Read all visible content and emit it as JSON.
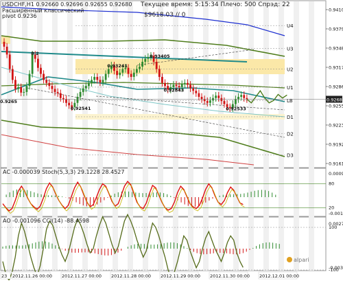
{
  "header": {
    "symbol_line": "USDCHF,H1  0.92660 0.92696 0.92655 0.92680",
    "pivot_caption": "Расширенный классический",
    "pivot_caption2": "pivot 0.9236",
    "time_line": "Текущее время: 5:15:34  Плечо: 500  Спрэд: 22",
    "balance_line": "$9618.03   // 0",
    "ac_line": "AC -0.000039  Stoch(5,3,3) 29.1228 28.4527",
    "ao_line": "AO -0.001096  CCI(14) -88.4598",
    "logo_text": "alpari"
  },
  "chart_data": [
    {
      "type": "line",
      "title": "USDCHF,H1",
      "y_ticks": [
        "0.94100",
        "0.93790",
        "0.93480",
        "0.93170",
        "0.92860",
        "0.92550",
        "0.92239",
        "0.91929",
        "0.91619"
      ],
      "ylim": [
        0.9156,
        0.943
      ],
      "price_label": "0.92680",
      "price": 0.9268,
      "pivot_levels": [
        {
          "name": "U4",
          "value": 0.939
        },
        {
          "name": "U3",
          "value": 0.9352
        },
        {
          "name": "U2",
          "value": 0.9318
        },
        {
          "name": "U1",
          "value": 0.9288
        },
        {
          "name": "LB",
          "value": 0.9266
        },
        {
          "name": "D1",
          "value": 0.9239
        },
        {
          "name": "D2",
          "value": 0.9211
        },
        {
          "name": "D3",
          "value": 0.9176
        }
      ],
      "annotations": [
        {
          "text": "0.9265",
          "x": 0,
          "y": 0.9265
        },
        {
          "text": "8.2",
          "x": 11,
          "y": 0.9345
        },
        {
          "text": "0.92541",
          "x": 25,
          "y": 0.9254
        },
        {
          "text": "0.93241",
          "x": 38,
          "y": 0.9324
        },
        {
          "text": "0.93405",
          "x": 53,
          "y": 0.934
        },
        {
          "text": "0.92843",
          "x": 58,
          "y": 0.9284
        },
        {
          "text": "0.92533",
          "x": 80,
          "y": 0.9253
        }
      ],
      "close": [
        0.9355,
        0.9342,
        0.9318,
        0.93,
        0.9285,
        0.9288,
        0.9279,
        0.928,
        0.929,
        0.931,
        0.9342,
        0.9335,
        0.932,
        0.931,
        0.93,
        0.9295,
        0.929,
        0.9285,
        0.928,
        0.9278,
        0.927,
        0.9268,
        0.9262,
        0.9258,
        0.9255,
        0.9262,
        0.9272,
        0.928,
        0.9286,
        0.929,
        0.9295,
        0.93,
        0.9305,
        0.93,
        0.9296,
        0.93,
        0.931,
        0.9318,
        0.9324,
        0.9315,
        0.9308,
        0.9312,
        0.9318,
        0.932,
        0.931,
        0.9305,
        0.9312,
        0.9318,
        0.9322,
        0.933,
        0.9335,
        0.9338,
        0.934,
        0.933,
        0.9318,
        0.9305,
        0.9295,
        0.929,
        0.9284,
        0.9288,
        0.9292,
        0.929,
        0.9288,
        0.9293,
        0.9295,
        0.9292,
        0.9286,
        0.9282,
        0.9278,
        0.9272,
        0.9268,
        0.9265,
        0.9262,
        0.9266,
        0.927,
        0.9274,
        0.927,
        0.9265,
        0.926,
        0.9255,
        0.9253,
        0.926,
        0.9268,
        0.9272,
        0.9275,
        0.927,
        0.9268
      ],
      "forecast": [
        0.9268,
        0.9262,
        0.9272,
        0.9282,
        0.927,
        0.9262,
        0.9266,
        0.9276,
        0.927,
        0.9275
      ],
      "x_ticks": [
        "23 Nov 2012",
        "2012.11.26 00:00",
        "2012.11.27 00:00",
        "2012.11.28 00:00",
        "2012.11.29 00:00",
        "2012.11.30 00:00",
        "2012.12.01 00:00"
      ]
    },
    {
      "type": "line",
      "title": "AC / Stoch(5,3,3)",
      "y_ticks": [
        "0.000948",
        "80",
        "20",
        "-0.00108"
      ],
      "stoch_main": [
        30,
        20,
        12,
        18,
        38,
        62,
        74,
        62,
        44,
        30,
        22,
        16,
        24,
        44,
        68,
        82,
        72,
        54,
        38,
        26,
        18,
        26,
        48,
        70,
        84,
        72,
        52,
        34,
        22,
        28,
        46,
        66,
        80,
        74,
        56,
        36,
        24,
        30,
        52,
        74,
        86,
        78,
        56,
        34,
        22,
        18,
        32,
        56,
        76,
        70,
        52,
        34,
        20,
        14,
        18,
        34,
        58,
        74,
        66,
        48,
        30,
        22,
        18,
        26,
        44,
        66,
        80,
        70,
        50,
        34,
        28,
        38,
        58,
        72,
        64,
        48,
        32,
        28
      ]
    },
    {
      "type": "line",
      "title": "AO / CCI(14)",
      "y_ticks": [
        "0.00273",
        "100",
        "-100",
        "-0.00353"
      ],
      "cci": [
        -60,
        -120,
        -150,
        -110,
        -40,
        60,
        120,
        80,
        20,
        -40,
        -90,
        -130,
        -80,
        0,
        90,
        130,
        110,
        60,
        10,
        -30,
        -60,
        -20,
        40,
        100,
        140,
        110,
        70,
        20,
        -20,
        0,
        60,
        110,
        150,
        120,
        70,
        20,
        -20,
        10,
        70,
        130,
        160,
        130,
        90,
        40,
        0,
        -40,
        -10,
        60,
        120,
        100,
        60,
        10,
        -40,
        -100,
        -140,
        -110,
        -60,
        0,
        60,
        40,
        -10,
        -50,
        -90,
        -60,
        0,
        50,
        80,
        40,
        0,
        -30,
        -60,
        -20,
        30,
        60,
        40,
        -20,
        -60,
        -88
      ]
    }
  ],
  "colors": {
    "candle_up": "#2f8b2f",
    "candle_down": "#d21414",
    "ma_blue": "#1d2fd0",
    "ma_olive": "#4f7d1c",
    "ma_teal": "#1f8a8a",
    "pivot_band": "#fbe8a8",
    "stoch_red": "#e01010",
    "cci_olive": "#556b1a"
  }
}
